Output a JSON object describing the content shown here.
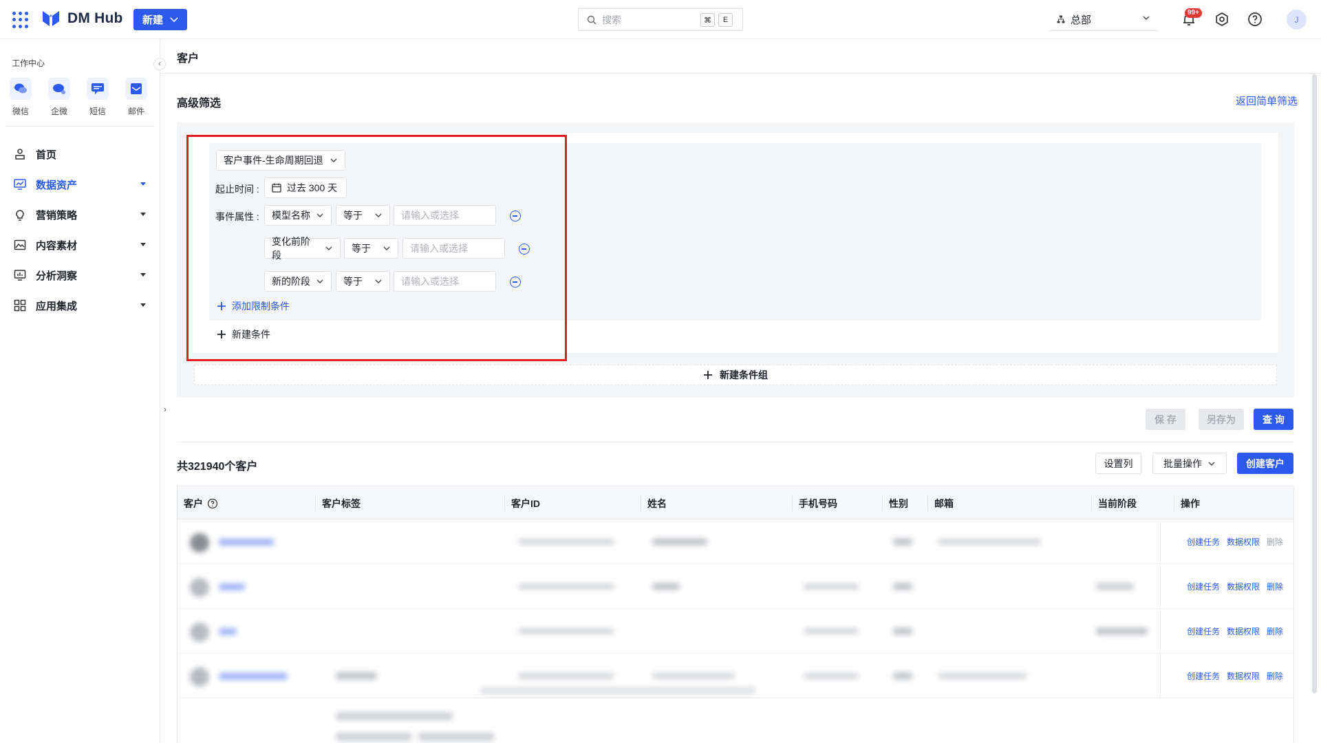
{
  "topbar": {
    "brand": "DM Hub",
    "new_button": "新建",
    "search_placeholder": "搜索",
    "shortcut_key1": "⌘",
    "shortcut_key2": "E",
    "org": "总部",
    "notification_badge": "99+",
    "avatar_letter": "J"
  },
  "sidebar": {
    "workspace_title": "工作中心",
    "workspace": [
      {
        "label": "微信",
        "icon": "wechat-icon"
      },
      {
        "label": "企微",
        "icon": "wecom-icon"
      },
      {
        "label": "短信",
        "icon": "sms-icon"
      },
      {
        "label": "邮件",
        "icon": "mail-icon"
      }
    ],
    "nav": [
      {
        "label": "首页",
        "icon": "home-icon"
      },
      {
        "label": "数据资产",
        "icon": "data-asset-icon",
        "active": true
      },
      {
        "label": "营销策略",
        "icon": "bulb-icon"
      },
      {
        "label": "内容素材",
        "icon": "image-icon"
      },
      {
        "label": "分析洞察",
        "icon": "monitor-icon"
      },
      {
        "label": "应用集成",
        "icon": "apps-grid-icon"
      }
    ]
  },
  "page": {
    "title": "客户",
    "advanced_filter": "高级筛选",
    "back_simple": "返回简单筛选"
  },
  "filter": {
    "event": "客户事件-生命周期回退",
    "time_label": "起止时间 :",
    "time_value": "过去 300 天",
    "attr_label": "事件属性 :",
    "rows": [
      {
        "field": "模型名称",
        "op": "等于",
        "placeholder": "请输入或选择"
      },
      {
        "field": "变化前阶段",
        "op": "等于",
        "placeholder": "请输入或选择"
      },
      {
        "field": "新的阶段",
        "op": "等于",
        "placeholder": "请输入或选择"
      }
    ],
    "add_restriction": "添加限制条件",
    "new_condition": "新建条件",
    "new_condition_group": "新建条件组"
  },
  "actions": {
    "save": "保 存",
    "save_as": "另存为",
    "query": "查 询"
  },
  "results": {
    "count_text": "共321940个客户",
    "set_columns": "设置列",
    "batch_ops": "批量操作",
    "create_customer": "创建客户"
  },
  "table": {
    "headers": [
      "客户",
      "客户标签",
      "客户ID",
      "姓名",
      "手机号码",
      "性别",
      "邮箱",
      "当前阶段",
      "操作"
    ],
    "row_actions": {
      "create_task": "创建任务",
      "data_permission": "数据权限",
      "delete": "删除"
    }
  },
  "colors": {
    "accent": "#2b5aed",
    "highlight": "#e11d1d"
  }
}
